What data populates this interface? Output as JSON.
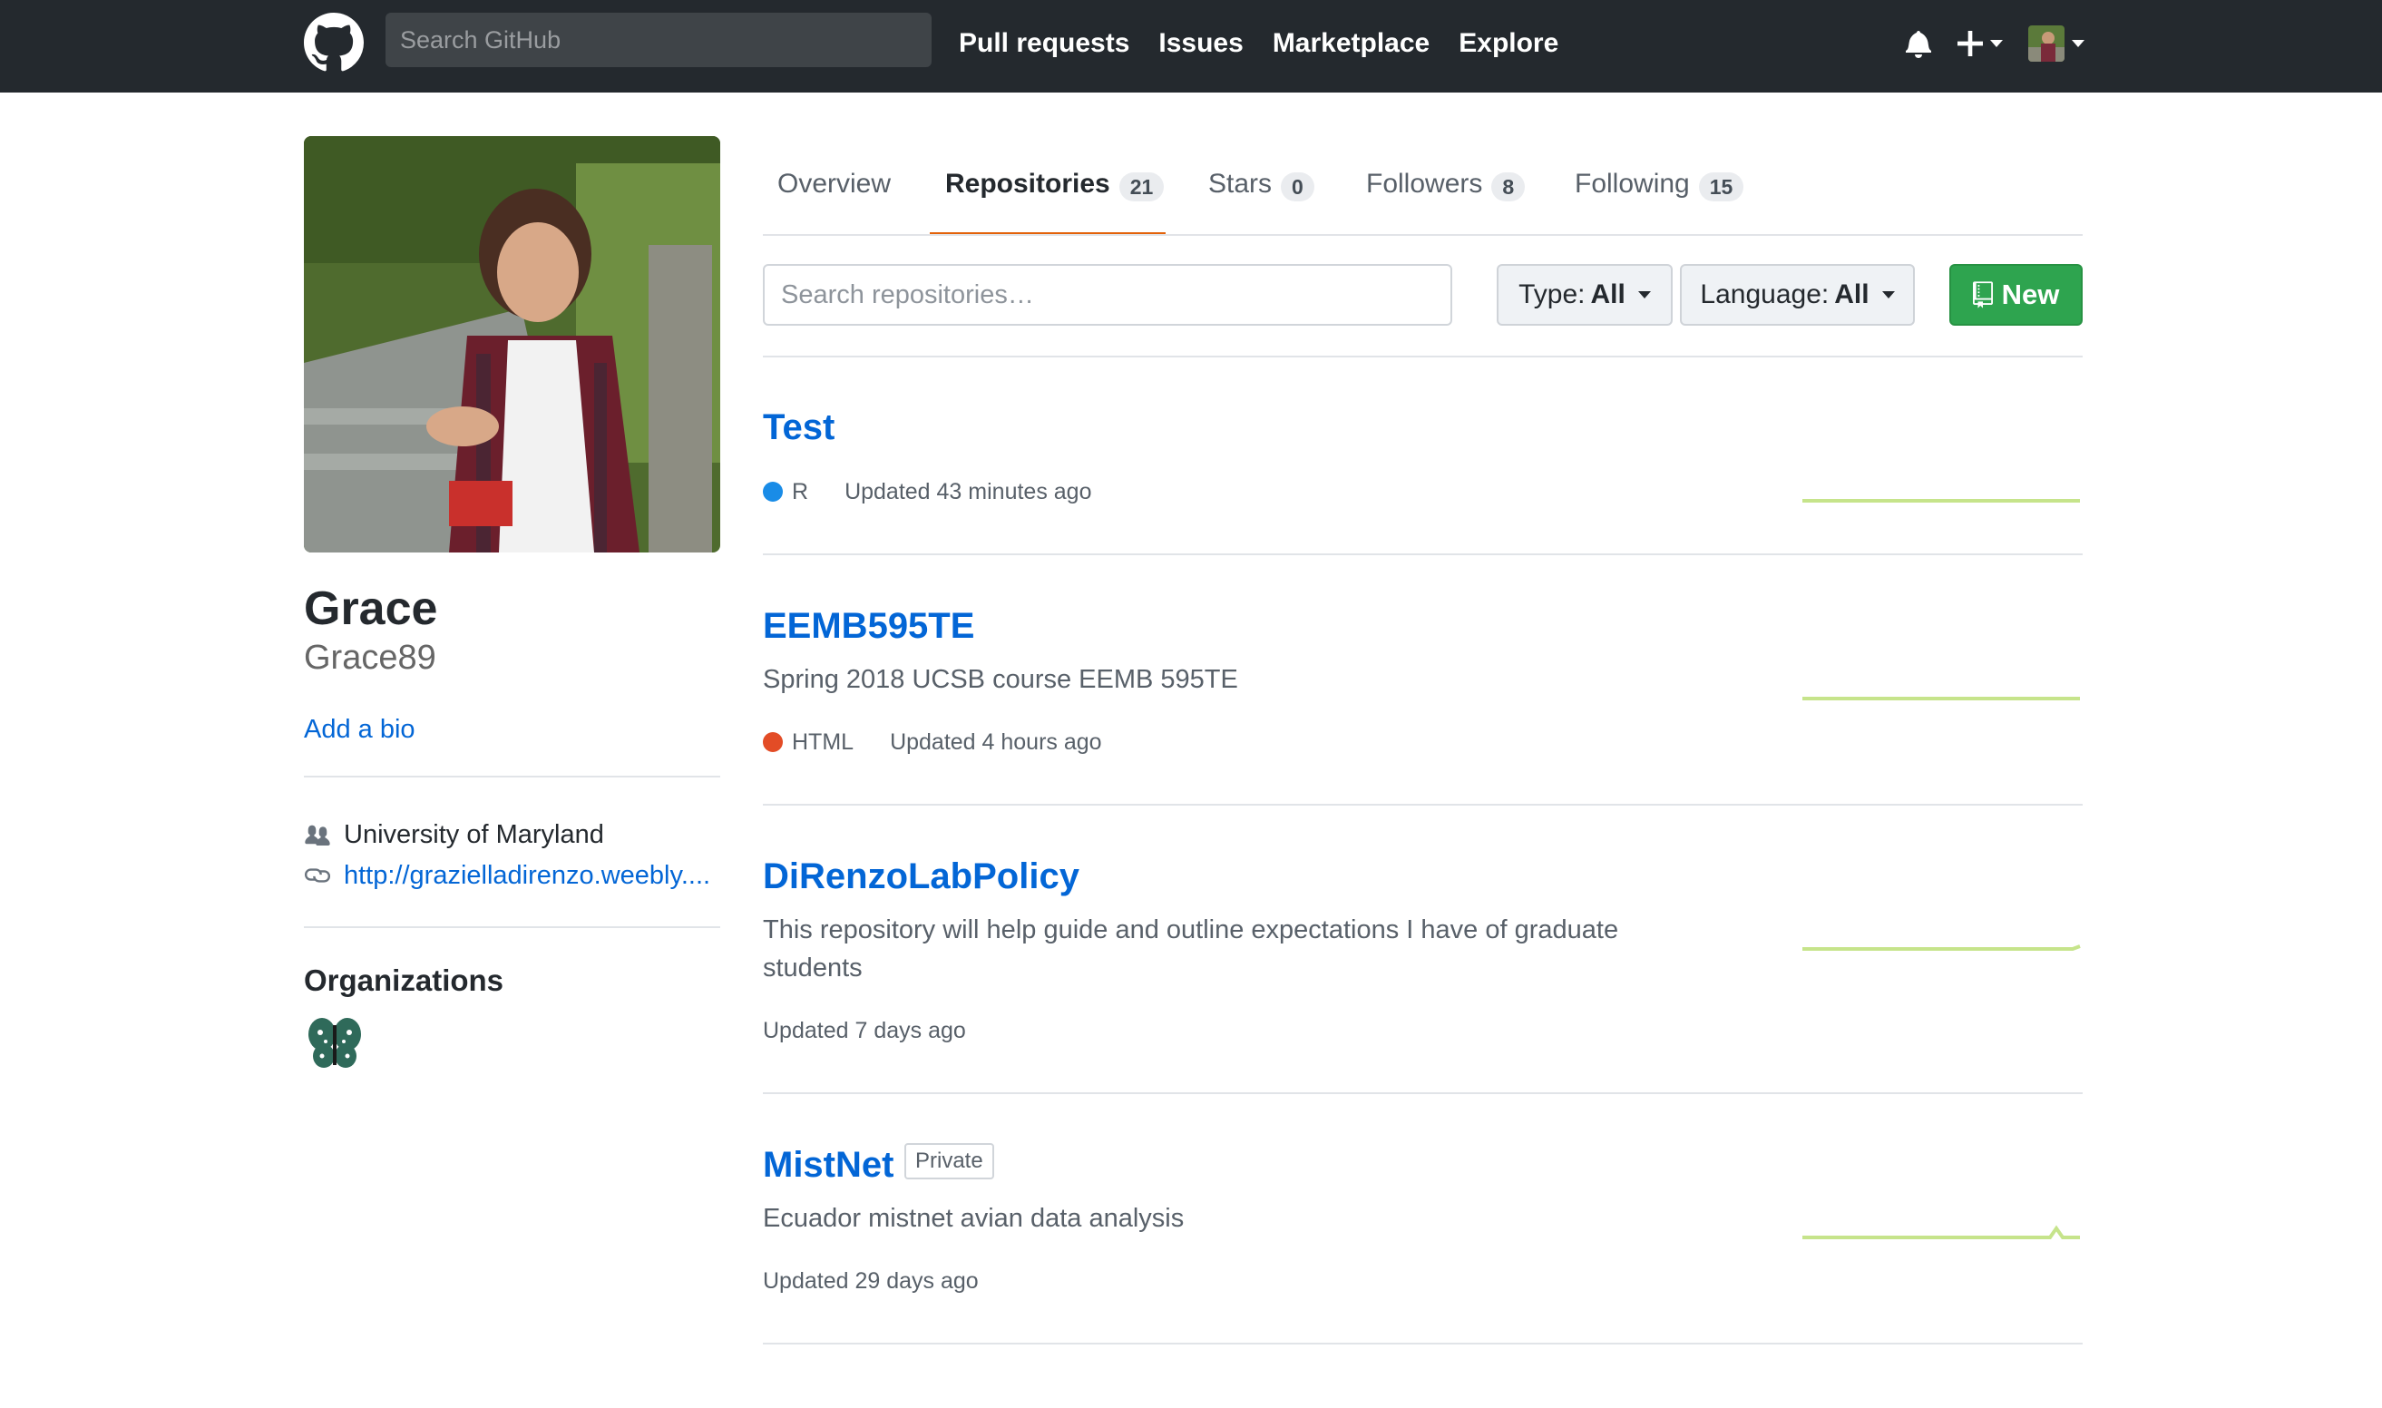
{
  "header": {
    "search_placeholder": "Search GitHub",
    "nav": [
      "Pull requests",
      "Issues",
      "Marketplace",
      "Explore"
    ],
    "icons": [
      "github-logo-icon",
      "bell-icon",
      "plus-icon",
      "caret-down-icon",
      "avatar"
    ]
  },
  "profile": {
    "fullname": "Grace",
    "username": "Grace89",
    "add_bio": "Add a bio",
    "organization": "University of Maryland",
    "website": "http://graziella​direnzo.weebly....",
    "organizations_heading": "Organizations"
  },
  "tabs": [
    {
      "label": "Overview",
      "count": null
    },
    {
      "label": "Repositories",
      "count": "21"
    },
    {
      "label": "Stars",
      "count": "0"
    },
    {
      "label": "Followers",
      "count": "8"
    },
    {
      "label": "Following",
      "count": "15"
    }
  ],
  "filters": {
    "search_placeholder": "Search repositories…",
    "type_label": "Type:",
    "type_value": "All",
    "language_label": "Language:",
    "language_value": "All",
    "new_label": "New"
  },
  "repos": [
    {
      "name": "Test",
      "description": "",
      "language": "R",
      "language_color": "#198ce7",
      "updated": "Updated 43 minutes ago",
      "private": false
    },
    {
      "name": "EEMB595TE",
      "description": "Spring 2018 UCSB course EEMB 595TE",
      "language": "HTML",
      "language_color": "#e34c26",
      "updated": "Updated 4 hours ago",
      "private": false
    },
    {
      "name": "DiRenzoLabPolicy",
      "description": "This repository will help guide and outline expectations I have of graduate students",
      "language": "",
      "language_color": "",
      "updated": "Updated 7 days ago",
      "private": false
    },
    {
      "name": "MistNet",
      "description": "Ecuador mistnet avian data analysis",
      "language": "",
      "language_color": "",
      "updated": "Updated 29 days ago",
      "private": true,
      "private_label": "Private"
    }
  ],
  "colors": {
    "header_bg": "#24292e",
    "link_blue": "#0366d6",
    "tab_underline": "#e36209",
    "new_button_green": "#2ea44f",
    "sparkline": "#c6e48b"
  }
}
